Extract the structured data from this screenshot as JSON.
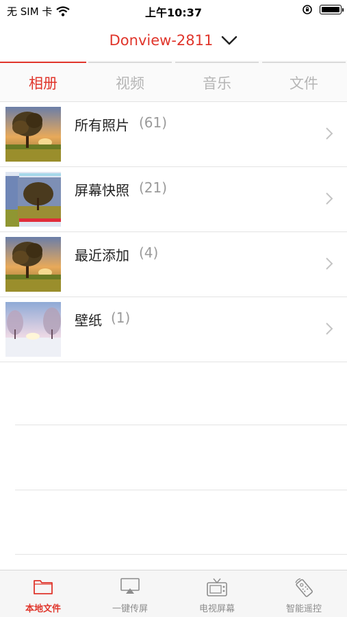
{
  "status_bar": {
    "carrier": "无 SIM 卡",
    "time": "上午10:37"
  },
  "header": {
    "device_name": "Donview-2811"
  },
  "tabs": [
    {
      "label": "相册",
      "active": true
    },
    {
      "label": "视频",
      "active": false
    },
    {
      "label": "音乐",
      "active": false
    },
    {
      "label": "文件",
      "active": false
    }
  ],
  "albums": [
    {
      "name": "所有照片",
      "count": "(61)"
    },
    {
      "name": "屏幕快照",
      "count": "(21)"
    },
    {
      "name": "最近添加",
      "count": "(4)"
    },
    {
      "name": "壁纸",
      "count": "(1)"
    }
  ],
  "bottom_tabs": [
    {
      "label": "本地文件",
      "icon": "folder-icon",
      "active": true
    },
    {
      "label": "一键传屏",
      "icon": "airplay-icon",
      "active": false
    },
    {
      "label": "电视屏幕",
      "icon": "tv-icon",
      "active": false
    },
    {
      "label": "智能遥控",
      "icon": "remote-icon",
      "active": false
    }
  ],
  "colors": {
    "accent": "#e0352b",
    "inactive": "#b5b5b5",
    "divider": "#e3e3e3"
  }
}
